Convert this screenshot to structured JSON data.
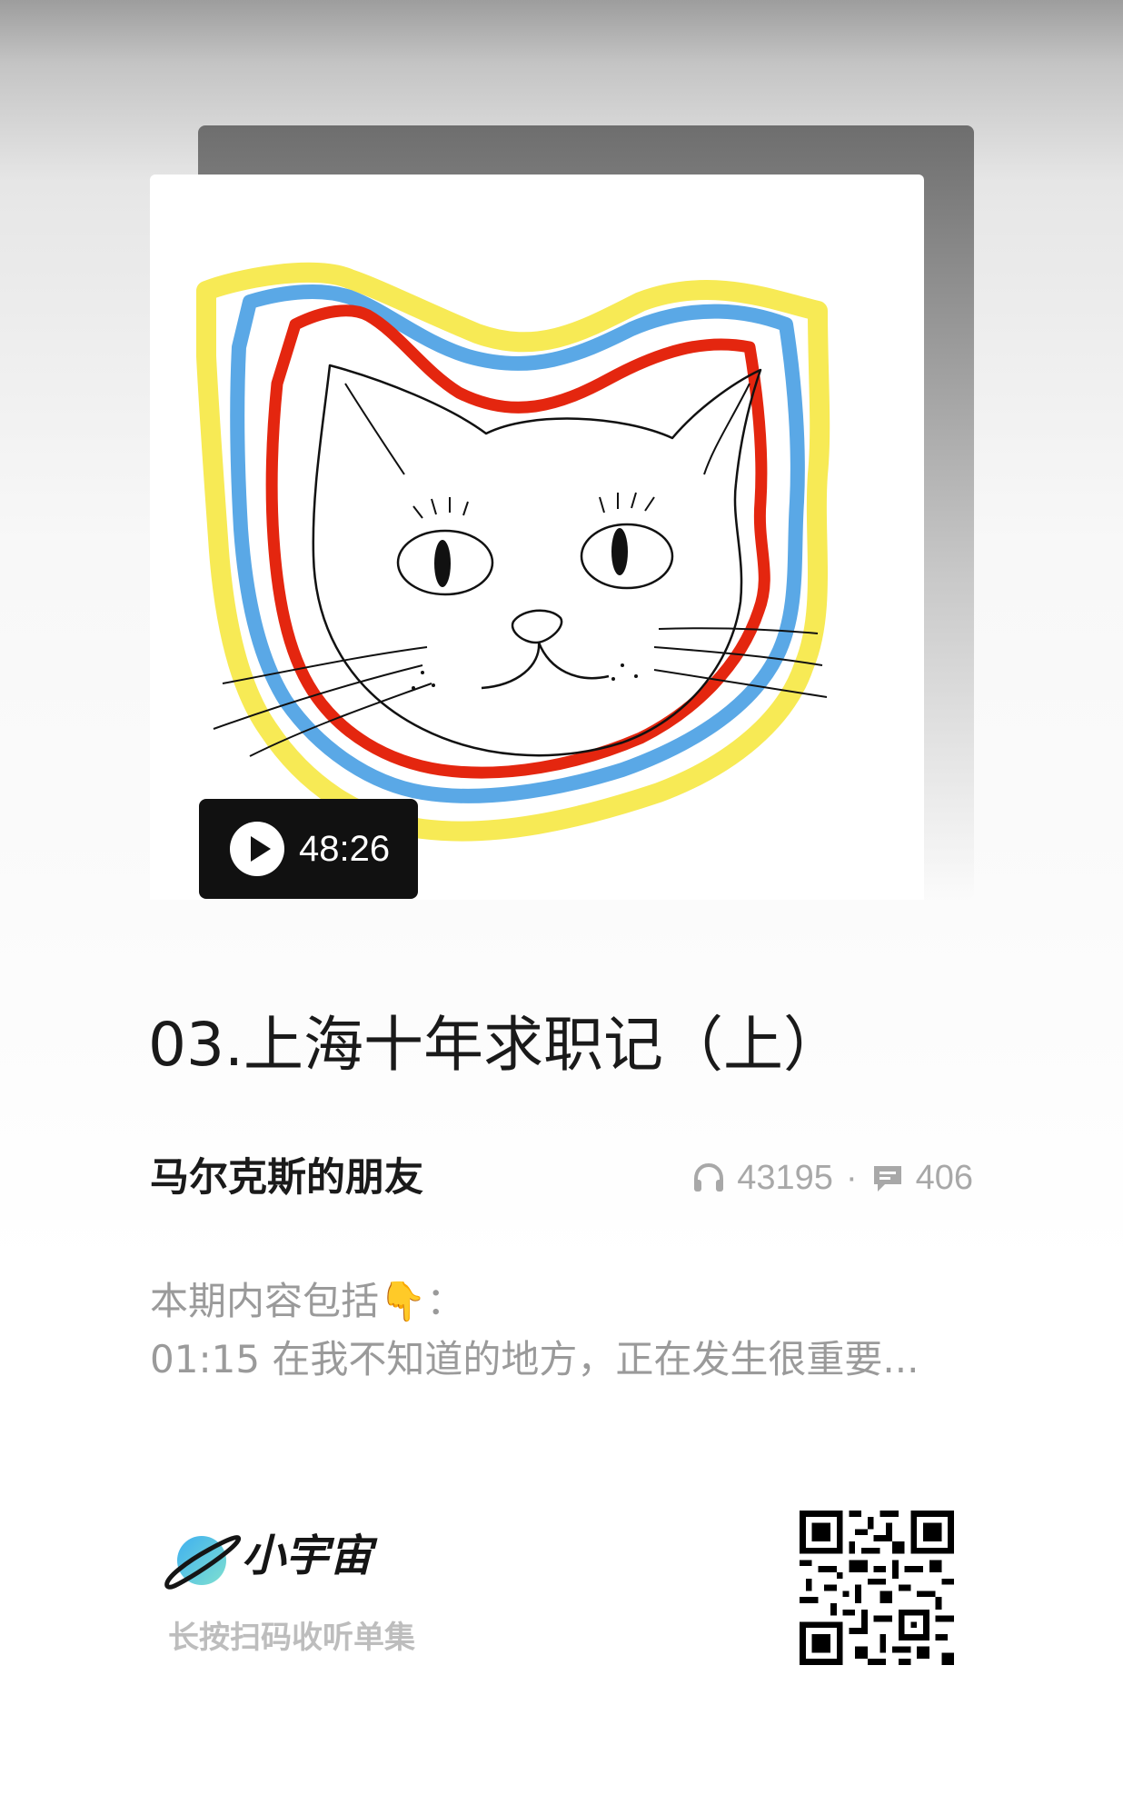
{
  "episode": {
    "title": "03.上海十年求职记（上）",
    "duration": "48:26",
    "podcast_name": "马尔克斯的朋友",
    "plays": "43195",
    "separator": "·",
    "comments": "406",
    "description": {
      "intro": "本期内容包括👇：",
      "first_item": "01:15 在我不知道的地方，正在发生很重要..."
    }
  },
  "branding": {
    "app_name": "小宇宙",
    "scan_hint": "长按扫码收听单集"
  },
  "icons": {
    "play": "play-icon",
    "headphones": "headphones-icon",
    "comment": "comment-icon",
    "logo": "planet-logo-icon",
    "qr": "qr-code"
  },
  "colors": {
    "cover_yellow": "#f7ea55",
    "cover_blue": "#5aa8e6",
    "cover_red": "#e4260f",
    "badge_bg": "#111111",
    "text_primary": "#1a1a1a",
    "text_secondary": "#9a9a9a"
  }
}
